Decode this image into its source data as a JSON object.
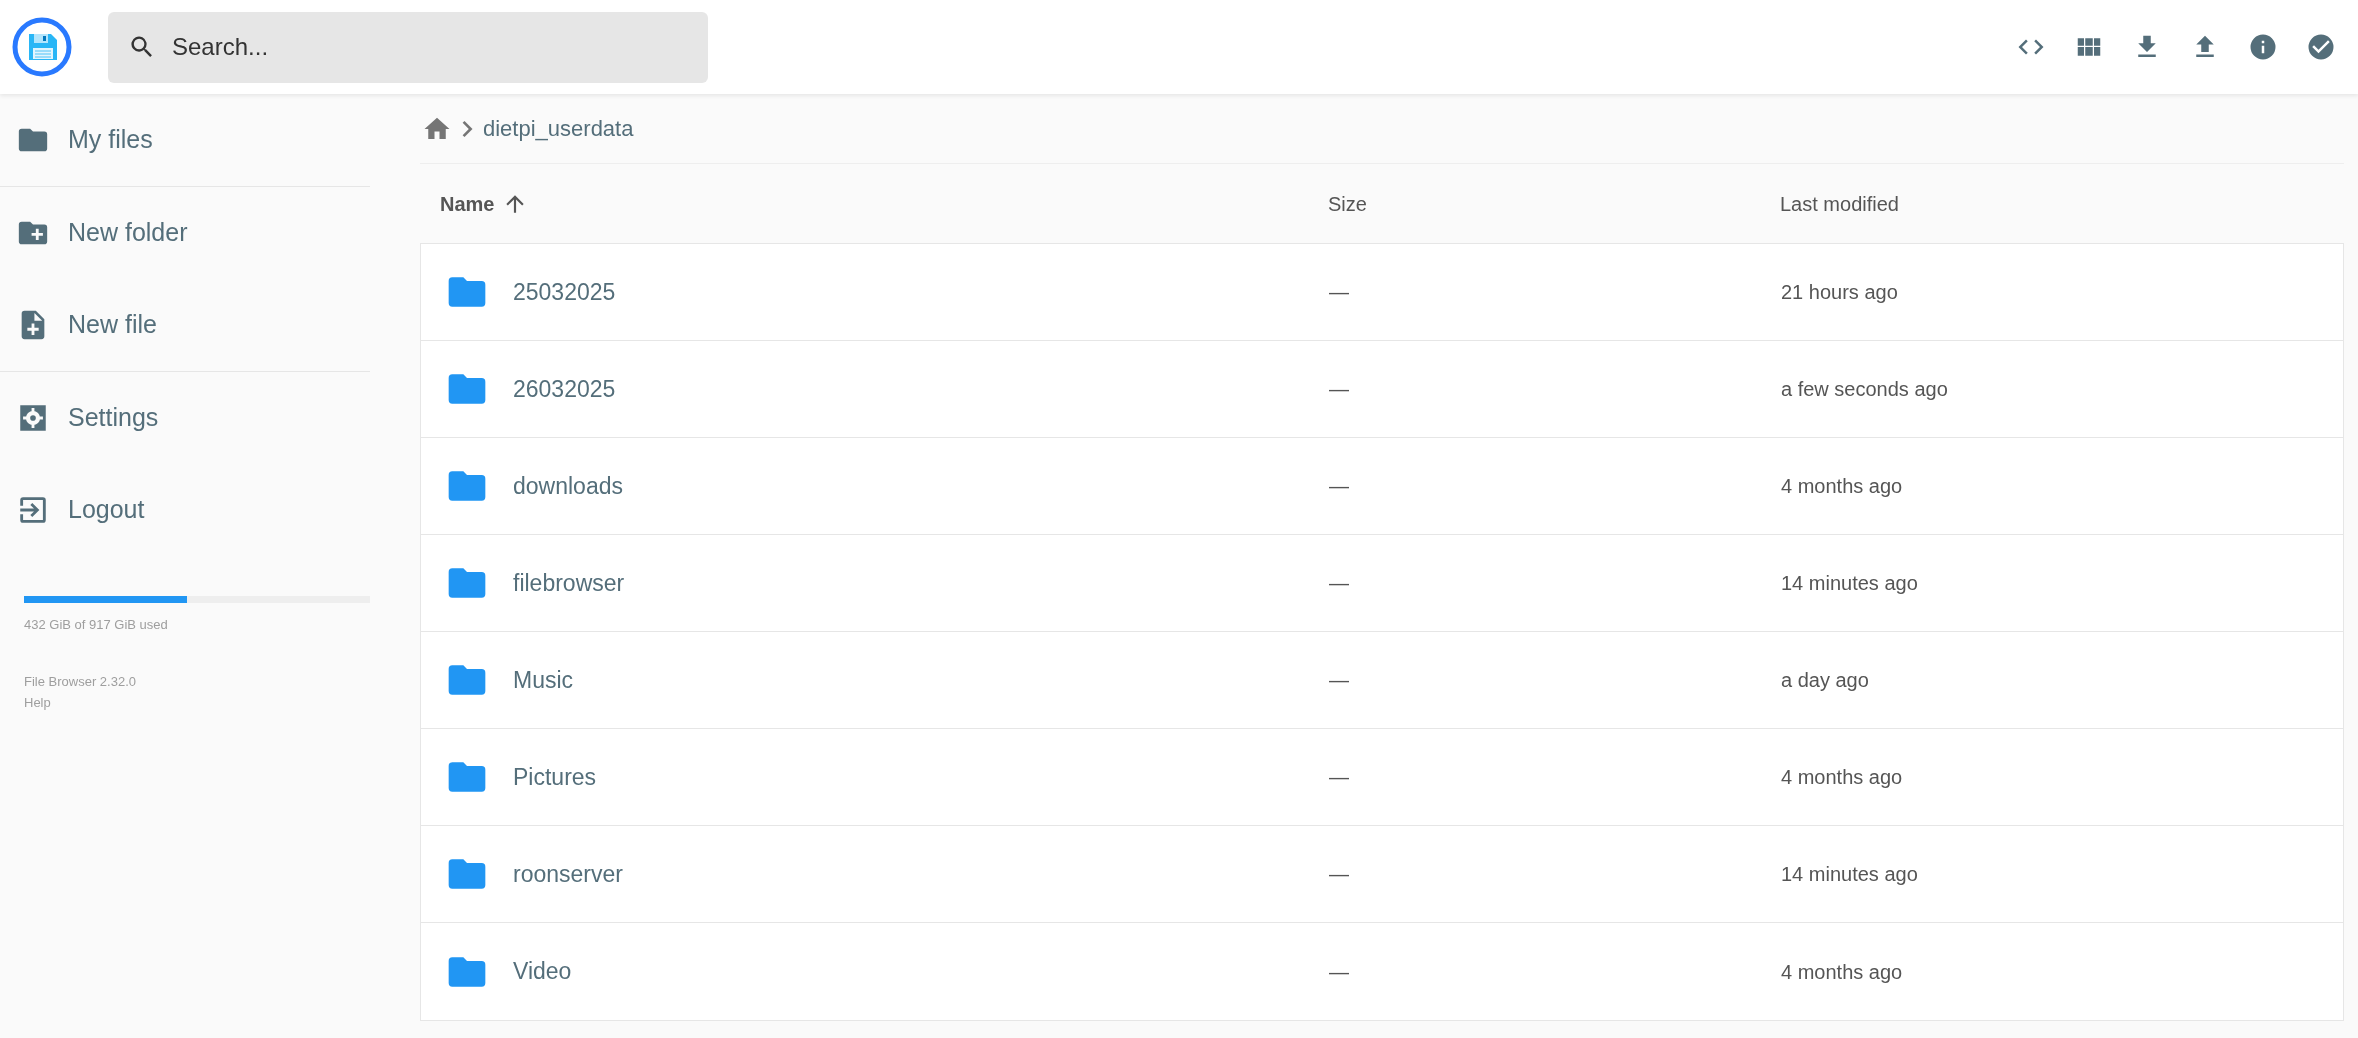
{
  "search": {
    "placeholder": "Search..."
  },
  "sidebar": {
    "groups": [
      [
        {
          "kind": "folder",
          "label": "My files"
        }
      ],
      [
        {
          "kind": "new-folder",
          "label": "New folder"
        },
        {
          "kind": "new-file",
          "label": "New file"
        }
      ],
      [
        {
          "kind": "settings",
          "label": "Settings"
        },
        {
          "kind": "logout",
          "label": "Logout"
        }
      ]
    ],
    "storage": {
      "level": 0.47,
      "text": "432 GiB of 917 GiB used"
    },
    "footer": [
      "File Browser 2.32.0",
      "Help"
    ]
  },
  "breadcrumb": [
    "dietpi_userdata"
  ],
  "table": {
    "columns": [
      {
        "label": "Name",
        "sorted": true
      },
      {
        "label": "Size",
        "sorted": false
      },
      {
        "label": "Last modified",
        "sorted": false
      }
    ],
    "rows": [
      {
        "name": "25032025",
        "size": "—",
        "modified": "21 hours ago"
      },
      {
        "name": "26032025",
        "size": "—",
        "modified": "a few seconds ago"
      },
      {
        "name": "downloads",
        "size": "—",
        "modified": "4 months ago"
      },
      {
        "name": "filebrowser",
        "size": "—",
        "modified": "14 minutes ago"
      },
      {
        "name": "Music",
        "size": "—",
        "modified": "a day ago"
      },
      {
        "name": "Pictures",
        "size": "—",
        "modified": "4 months ago"
      },
      {
        "name": "roonserver",
        "size": "—",
        "modified": "14 minutes ago"
      },
      {
        "name": "Video",
        "size": "—",
        "modified": "4 months ago"
      }
    ]
  }
}
